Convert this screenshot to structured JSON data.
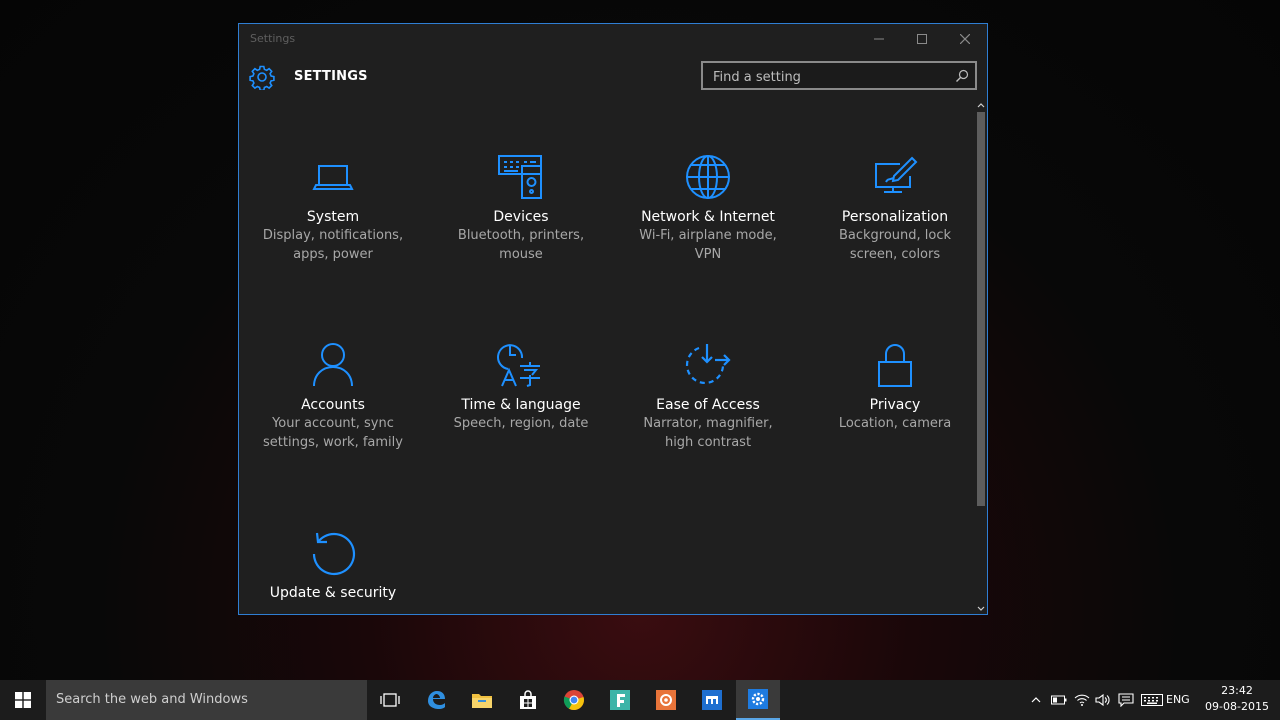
{
  "window": {
    "title": "Settings",
    "app_title": "SETTINGS",
    "search_placeholder": "Find a setting"
  },
  "tiles": [
    {
      "title": "System",
      "desc_line1": "Display, notifications,",
      "desc_line2": "apps, power",
      "icon": "laptop-icon"
    },
    {
      "title": "Devices",
      "desc_line1": "Bluetooth, printers,",
      "desc_line2": "mouse",
      "icon": "devices-icon"
    },
    {
      "title": "Network & Internet",
      "desc_line1": "Wi-Fi, airplane mode,",
      "desc_line2": "VPN",
      "icon": "globe-icon"
    },
    {
      "title": "Personalization",
      "desc_line1": "Background, lock",
      "desc_line2": "screen, colors",
      "icon": "paint-icon"
    },
    {
      "title": "Accounts",
      "desc_line1": "Your account, sync",
      "desc_line2": "settings, work, family",
      "icon": "person-icon"
    },
    {
      "title": "Time & language",
      "desc_line1": "Speech, region, date",
      "desc_line2": "",
      "icon": "time-language-icon"
    },
    {
      "title": "Ease of Access",
      "desc_line1": "Narrator, magnifier,",
      "desc_line2": "high contrast",
      "icon": "ease-of-access-icon"
    },
    {
      "title": "Privacy",
      "desc_line1": "Location, camera",
      "desc_line2": "",
      "icon": "lock-icon"
    },
    {
      "title": "Update & security",
      "desc_line1": "",
      "desc_line2": "",
      "icon": "update-icon"
    }
  ],
  "taskbar": {
    "search_placeholder": "Search the web and Windows",
    "language": "ENG",
    "time": "23:42",
    "date": "09-08-2015",
    "apps": [
      "task-view-icon",
      "edge-icon",
      "file-explorer-icon",
      "store-icon",
      "chrome-icon",
      "f-app-icon",
      "orange-app-icon",
      "remote-app-icon",
      "settings-app-icon"
    ]
  },
  "colors": {
    "accent": "#1e90ff",
    "window_bg": "#1f1f1f",
    "taskbar_bg": "#1c1c1c"
  }
}
